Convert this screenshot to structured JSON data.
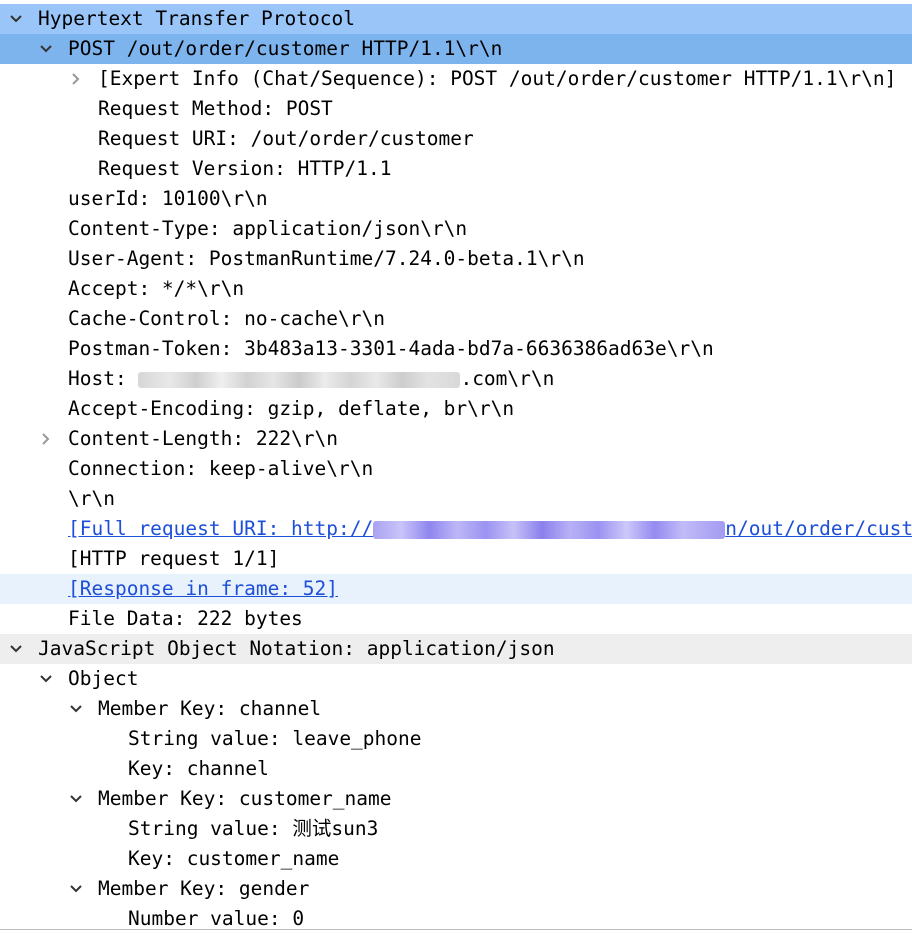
{
  "colors": {
    "selected_row": "#99c5f8",
    "selected_subrow": "#7eb4ee",
    "hover_row": "#e8f2fd",
    "section_header": "#eeeeee",
    "link": "#1d4fd8",
    "text": "#000000",
    "redaction_host": "#d7d7d7",
    "redaction_uri": "#a9a2f3"
  },
  "icons": {
    "expanded": "chevron-down-icon",
    "collapsed": "chevron-right-icon"
  },
  "http": {
    "section_label": "Hypertext Transfer Protocol",
    "request_line": "POST /out/order/customer HTTP/1.1\\r\\n",
    "expert_info": "[Expert Info (Chat/Sequence): POST /out/order/customer HTTP/1.1\\r\\n]",
    "request_method": "Request Method: POST",
    "request_uri": "Request URI: /out/order/customer",
    "request_version": "Request Version: HTTP/1.1",
    "user_id": "userId: 10100\\r\\n",
    "content_type": "Content-Type: application/json\\r\\n",
    "user_agent": "User-Agent: PostmanRuntime/7.24.0-beta.1\\r\\n",
    "accept": "Accept: */*\\r\\n",
    "cache_control": "Cache-Control: no-cache\\r\\n",
    "postman_token": "Postman-Token: 3b483a13-3301-4ada-bd7a-6636386ad63e\\r\\n",
    "host_prefix": "Host: ",
    "host_suffix": ".com\\r\\n",
    "accept_encoding": "Accept-Encoding: gzip, deflate, br\\r\\n",
    "content_length": "Content-Length: 222\\r\\n",
    "connection": "Connection: keep-alive\\r\\n",
    "blank_line": "\\r\\n",
    "full_uri_prefix": "[Full request URI: http://",
    "full_uri_suffix": "n/out/order/cust",
    "http_request": "[HTTP request 1/1]",
    "response_in_frame": "[Response in frame: 52]",
    "file_data": "File Data: 222 bytes"
  },
  "json": {
    "section_label": "JavaScript Object Notation: application/json",
    "object_label": "Object",
    "members": [
      {
        "member_key": "Member Key: channel",
        "value": "String value: leave_phone",
        "key": "Key: channel"
      },
      {
        "member_key": "Member Key: customer_name",
        "value": "String value: 测试sun3",
        "key": "Key: customer_name"
      },
      {
        "member_key": "Member Key: gender",
        "value": "Number value: 0"
      }
    ]
  }
}
